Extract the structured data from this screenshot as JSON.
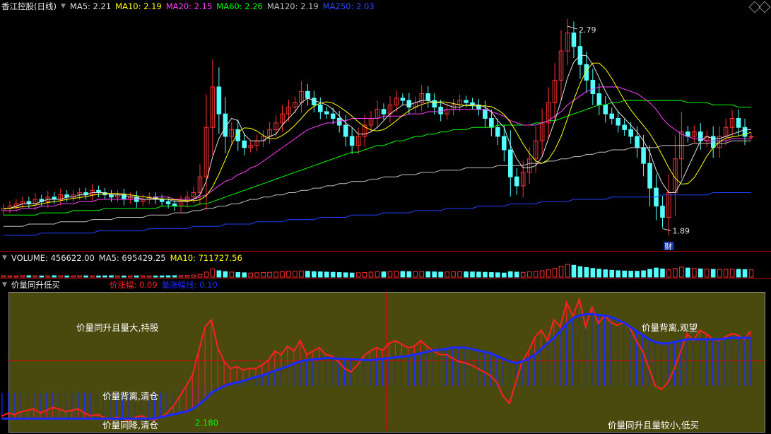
{
  "main_header": {
    "title": "香江控股(日线)",
    "ma5": "MA5: 2.21",
    "ma10": "MA10: 2.19",
    "ma20": "MA20: 2.15",
    "ma60": "MA60: 2.26",
    "ma120": "MA120: 2.19",
    "ma250": "MA250: 2.03"
  },
  "price_high_label": "2.79",
  "price_low_label": "1.89",
  "fin_badge": "财",
  "volume_header": {
    "volume": "VOLUME: 456622.00",
    "ma5": "MA5: 695429.25",
    "ma10": "MA10: 711727.56"
  },
  "indicator_header": {
    "name": "价量同升低买",
    "price_rise": "价涨幅: 0.09",
    "volume_line": "量涨幅线: 0.10"
  },
  "annotations": {
    "top_left": "价量同升且量大,持股",
    "top_right": "价量背离,观望",
    "mid_left": "价量背离,清仓",
    "bottom_left": "价量同降,清仓",
    "bottom_right": "价量同升且量较小,低买",
    "value_label": "2.180"
  },
  "colors": {
    "up": "#ff3232",
    "down": "#54ffff",
    "ma5": "#e0e0e0",
    "ma10": "#ffff00",
    "ma20": "#ff40ff",
    "ma60": "#00ff00",
    "ma120": "#c0c0c0",
    "ma250": "#2040ff",
    "price_rise": "#ff2020",
    "volume_line": "#1a2aff"
  },
  "chart_data": [
    {
      "type": "candlestick",
      "title": "香江控股(日线)",
      "ylim": [
        1.8,
        2.85
      ],
      "high_marker": 2.79,
      "low_marker": 1.89,
      "close": [
        1.98,
        1.99,
        2.0,
        2.01,
        2.0,
        2.02,
        2.01,
        2.03,
        2.02,
        2.04,
        2.03,
        2.04,
        2.05,
        2.04,
        2.06,
        2.05,
        2.04,
        2.03,
        2.04,
        2.02,
        2.03,
        2.01,
        2.02,
        2.03,
        2.02,
        2.01,
        2.0,
        1.99,
        2.01,
        2.03,
        2.05,
        2.12,
        2.34,
        2.52,
        2.4,
        2.3,
        2.33,
        2.28,
        2.25,
        2.26,
        2.28,
        2.3,
        2.33,
        2.36,
        2.4,
        2.43,
        2.45,
        2.5,
        2.47,
        2.44,
        2.41,
        2.4,
        2.38,
        2.35,
        2.3,
        2.26,
        2.3,
        2.35,
        2.38,
        2.42,
        2.4,
        2.44,
        2.47,
        2.46,
        2.43,
        2.45,
        2.49,
        2.46,
        2.43,
        2.4,
        2.42,
        2.44,
        2.46,
        2.45,
        2.44,
        2.42,
        2.38,
        2.34,
        2.3,
        2.24,
        2.12,
        2.08,
        2.14,
        2.2,
        2.28,
        2.36,
        2.45,
        2.55,
        2.68,
        2.76,
        2.7,
        2.62,
        2.55,
        2.49,
        2.44,
        2.4,
        2.38,
        2.35,
        2.33,
        2.3,
        2.25,
        2.18,
        2.07,
        1.99,
        1.94,
        2.05,
        2.2,
        2.32,
        2.3,
        2.32,
        2.28,
        2.3,
        2.25,
        2.3,
        2.34,
        2.38,
        2.34,
        2.3,
        2.3
      ],
      "ma5": [
        1.98,
        1.98,
        1.99,
        2.0,
        2.0,
        2.0,
        2.01,
        2.02,
        2.02,
        2.02,
        2.03,
        2.03,
        2.04,
        2.04,
        2.05,
        2.05,
        2.05,
        2.04,
        2.04,
        2.04,
        2.03,
        2.03,
        2.02,
        2.02,
        2.02,
        2.02,
        2.02,
        2.01,
        2.01,
        2.01,
        2.02,
        2.04,
        2.1,
        2.21,
        2.29,
        2.34,
        2.38,
        2.37,
        2.31,
        2.28,
        2.28,
        2.28,
        2.3,
        2.31,
        2.35,
        2.38,
        2.41,
        2.45,
        2.47,
        2.46,
        2.45,
        2.44,
        2.42,
        2.39,
        2.36,
        2.34,
        2.31,
        2.31,
        2.32,
        2.34,
        2.37,
        2.4,
        2.42,
        2.44,
        2.44,
        2.45,
        2.46,
        2.46,
        2.45,
        2.45,
        2.44,
        2.43,
        2.43,
        2.44,
        2.44,
        2.44,
        2.43,
        2.41,
        2.37,
        2.34,
        2.26,
        2.2,
        2.16,
        2.16,
        2.17,
        2.21,
        2.29,
        2.37,
        2.46,
        2.56,
        2.63,
        2.66,
        2.66,
        2.62,
        2.56,
        2.5,
        2.45,
        2.41,
        2.38,
        2.35,
        2.32,
        2.28,
        2.23,
        2.15,
        2.09,
        2.05,
        2.05,
        2.1,
        2.16,
        2.22,
        2.28,
        2.3,
        2.29,
        2.29,
        2.3,
        2.31,
        2.32,
        2.33,
        2.33
      ],
      "ma20": [
        1.97,
        1.97,
        1.97,
        1.98,
        1.98,
        1.98,
        1.99,
        1.99,
        1.99,
        2.0,
        2.0,
        2.0,
        2.01,
        2.01,
        2.01,
        2.02,
        2.02,
        2.02,
        2.02,
        2.02,
        2.02,
        2.02,
        2.02,
        2.02,
        2.03,
        2.03,
        2.03,
        2.02,
        2.02,
        2.02,
        2.02,
        2.03,
        2.04,
        2.06,
        2.08,
        2.1,
        2.11,
        2.13,
        2.14,
        2.16,
        2.17,
        2.19,
        2.21,
        2.23,
        2.25,
        2.27,
        2.29,
        2.31,
        2.33,
        2.34,
        2.35,
        2.36,
        2.36,
        2.37,
        2.37,
        2.38,
        2.38,
        2.38,
        2.38,
        2.38,
        2.39,
        2.39,
        2.39,
        2.39,
        2.4,
        2.4,
        2.4,
        2.41,
        2.41,
        2.41,
        2.42,
        2.42,
        2.42,
        2.42,
        2.42,
        2.42,
        2.42,
        2.41,
        2.4,
        2.39,
        2.37,
        2.36,
        2.35,
        2.35,
        2.35,
        2.36,
        2.37,
        2.39,
        2.41,
        2.44,
        2.46,
        2.48,
        2.5,
        2.51,
        2.52,
        2.52,
        2.52,
        2.52,
        2.51,
        2.5,
        2.49,
        2.47,
        2.45,
        2.42,
        2.38,
        2.35,
        2.33,
        2.31,
        2.3,
        2.29,
        2.29,
        2.28,
        2.28,
        2.28,
        2.28,
        2.29,
        2.29,
        2.29,
        2.29
      ],
      "ma60": [
        1.95,
        1.95,
        1.95,
        1.95,
        1.95,
        1.95,
        1.96,
        1.96,
        1.96,
        1.96,
        1.96,
        1.97,
        1.97,
        1.97,
        1.97,
        1.97,
        1.98,
        1.98,
        1.98,
        1.98,
        1.98,
        1.98,
        1.98,
        1.98,
        1.98,
        1.99,
        1.99,
        1.99,
        1.99,
        1.99,
        1.99,
        2.0,
        2.0,
        2.01,
        2.02,
        2.03,
        2.04,
        2.05,
        2.06,
        2.07,
        2.08,
        2.09,
        2.1,
        2.11,
        2.12,
        2.13,
        2.14,
        2.15,
        2.16,
        2.17,
        2.18,
        2.19,
        2.2,
        2.21,
        2.22,
        2.23,
        2.23,
        2.24,
        2.25,
        2.26,
        2.26,
        2.27,
        2.28,
        2.28,
        2.29,
        2.3,
        2.3,
        2.31,
        2.31,
        2.32,
        2.32,
        2.33,
        2.33,
        2.33,
        2.34,
        2.34,
        2.34,
        2.34,
        2.35,
        2.35,
        2.35,
        2.35,
        2.35,
        2.35,
        2.36,
        2.36,
        2.37,
        2.37,
        2.38,
        2.39,
        2.4,
        2.41,
        2.42,
        2.43,
        2.44,
        2.44,
        2.45,
        2.45,
        2.46,
        2.46,
        2.46,
        2.46,
        2.46,
        2.46,
        2.46,
        2.46,
        2.46,
        2.46,
        2.45,
        2.45,
        2.45,
        2.45,
        2.44,
        2.44,
        2.44,
        2.44,
        2.43,
        2.43,
        2.43
      ],
      "ma120": [
        1.9,
        1.9,
        1.9,
        1.9,
        1.91,
        1.91,
        1.91,
        1.91,
        1.91,
        1.92,
        1.92,
        1.92,
        1.92,
        1.92,
        1.93,
        1.93,
        1.93,
        1.93,
        1.94,
        1.94,
        1.94,
        1.94,
        1.94,
        1.95,
        1.95,
        1.95,
        1.95,
        1.96,
        1.96,
        1.96,
        1.97,
        1.97,
        1.98,
        1.98,
        1.99,
        1.99,
        2.0,
        2.0,
        2.01,
        2.02,
        2.02,
        2.03,
        2.03,
        2.04,
        2.04,
        2.05,
        2.05,
        2.06,
        2.06,
        2.07,
        2.07,
        2.08,
        2.08,
        2.09,
        2.09,
        2.1,
        2.1,
        2.1,
        2.11,
        2.11,
        2.12,
        2.12,
        2.12,
        2.13,
        2.13,
        2.13,
        2.14,
        2.14,
        2.14,
        2.15,
        2.15,
        2.15,
        2.15,
        2.16,
        2.16,
        2.16,
        2.16,
        2.16,
        2.17,
        2.17,
        2.17,
        2.17,
        2.17,
        2.18,
        2.18,
        2.18,
        2.19,
        2.19,
        2.2,
        2.2,
        2.21,
        2.21,
        2.22,
        2.22,
        2.23,
        2.23,
        2.24,
        2.24,
        2.24,
        2.25,
        2.25,
        2.25,
        2.25,
        2.25,
        2.26,
        2.26,
        2.26,
        2.26,
        2.26,
        2.27,
        2.27,
        2.27,
        2.27,
        2.27,
        2.27,
        2.28,
        2.28,
        2.28,
        2.28
      ],
      "ma250": [
        1.86,
        1.86,
        1.86,
        1.86,
        1.86,
        1.86,
        1.87,
        1.87,
        1.87,
        1.87,
        1.87,
        1.87,
        1.87,
        1.87,
        1.87,
        1.88,
        1.88,
        1.88,
        1.88,
        1.88,
        1.88,
        1.88,
        1.88,
        1.89,
        1.89,
        1.89,
        1.89,
        1.89,
        1.89,
        1.89,
        1.9,
        1.9,
        1.9,
        1.9,
        1.9,
        1.91,
        1.91,
        1.91,
        1.91,
        1.91,
        1.92,
        1.92,
        1.92,
        1.92,
        1.92,
        1.93,
        1.93,
        1.93,
        1.93,
        1.93,
        1.94,
        1.94,
        1.94,
        1.94,
        1.94,
        1.95,
        1.95,
        1.95,
        1.95,
        1.95,
        1.96,
        1.96,
        1.96,
        1.96,
        1.96,
        1.97,
        1.97,
        1.97,
        1.97,
        1.97,
        1.98,
        1.98,
        1.98,
        1.98,
        1.98,
        1.99,
        1.99,
        1.99,
        1.99,
        1.99,
        2.0,
        2.0,
        2.0,
        2.0,
        2.0,
        2.01,
        2.01,
        2.01,
        2.01,
        2.01,
        2.02,
        2.02,
        2.02,
        2.02,
        2.02,
        2.02,
        2.03,
        2.03,
        2.03,
        2.03,
        2.03,
        2.03,
        2.03,
        2.03,
        2.04,
        2.04,
        2.04,
        2.04,
        2.04,
        2.04,
        2.04,
        2.04,
        2.05,
        2.05,
        2.05,
        2.05,
        2.05,
        2.05,
        2.05
      ]
    },
    {
      "type": "bar",
      "title": "VOLUME",
      "values": [
        30,
        28,
        26,
        32,
        30,
        28,
        25,
        27,
        30,
        29,
        26,
        28,
        30,
        27,
        26,
        25,
        28,
        30,
        27,
        26,
        25,
        27,
        28,
        26,
        25,
        27,
        29,
        31,
        34,
        38,
        45,
        60,
        110,
        180,
        140,
        120,
        110,
        100,
        95,
        90,
        95,
        100,
        105,
        110,
        120,
        130,
        125,
        135,
        130,
        120,
        115,
        110,
        105,
        100,
        95,
        90,
        95,
        100,
        110,
        120,
        115,
        125,
        130,
        125,
        120,
        118,
        122,
        118,
        115,
        110,
        112,
        115,
        118,
        116,
        114,
        110,
        105,
        100,
        95,
        90,
        120,
        110,
        105,
        115,
        125,
        140,
        160,
        190,
        240,
        280,
        260,
        230,
        210,
        190,
        175,
        160,
        150,
        140,
        135,
        130,
        128,
        140,
        170,
        200,
        180,
        160,
        190,
        220,
        200,
        190,
        180,
        175,
        170,
        168,
        172,
        176,
        170,
        165,
        160
      ]
    },
    {
      "type": "line",
      "title": "价量同升低买",
      "ylim": [
        1.4,
        3.4
      ],
      "series": [
        {
          "name": "价涨幅",
          "values": [
            1.62,
            1.66,
            1.64,
            1.68,
            1.7,
            1.72,
            1.66,
            1.7,
            1.74,
            1.72,
            1.68,
            1.7,
            1.72,
            1.66,
            1.62,
            1.64,
            1.6,
            1.56,
            1.6,
            1.58,
            1.55,
            1.6,
            1.62,
            1.58,
            1.56,
            1.6,
            1.66,
            1.76,
            1.9,
            2.05,
            2.2,
            2.55,
            2.9,
            3.0,
            2.6,
            2.4,
            2.3,
            2.33,
            2.28,
            2.3,
            2.3,
            2.35,
            2.42,
            2.55,
            2.5,
            2.62,
            2.55,
            2.7,
            2.5,
            2.55,
            2.6,
            2.5,
            2.48,
            2.4,
            2.3,
            2.25,
            2.35,
            2.48,
            2.55,
            2.6,
            2.56,
            2.66,
            2.7,
            2.65,
            2.6,
            2.62,
            2.7,
            2.62,
            2.55,
            2.5,
            2.5,
            2.45,
            2.4,
            2.38,
            2.35,
            2.3,
            2.25,
            2.2,
            2.1,
            1.9,
            1.8,
            2.1,
            2.4,
            2.55,
            2.75,
            2.85,
            2.7,
            3.0,
            2.9,
            3.25,
            3.05,
            3.3,
            2.9,
            3.18,
            2.95,
            3.06,
            2.96,
            2.92,
            2.96,
            2.88,
            2.7,
            2.55,
            2.3,
            2.05,
            2.0,
            2.1,
            2.3,
            2.55,
            2.8,
            2.7,
            2.85,
            2.8,
            2.72,
            2.7,
            2.75,
            2.8,
            2.78,
            2.72,
            2.84
          ]
        },
        {
          "name": "量涨幅线",
          "values": [
            1.58,
            1.58,
            1.58,
            1.58,
            1.58,
            1.58,
            1.58,
            1.58,
            1.58,
            1.58,
            1.58,
            1.58,
            1.58,
            1.58,
            1.58,
            1.58,
            1.58,
            1.58,
            1.58,
            1.58,
            1.58,
            1.58,
            1.58,
            1.58,
            1.58,
            1.6,
            1.62,
            1.64,
            1.66,
            1.68,
            1.72,
            1.78,
            1.86,
            1.95,
            2.0,
            2.05,
            2.08,
            2.1,
            2.12,
            2.15,
            2.18,
            2.2,
            2.23,
            2.27,
            2.3,
            2.33,
            2.37,
            2.4,
            2.42,
            2.43,
            2.44,
            2.45,
            2.45,
            2.44,
            2.44,
            2.43,
            2.43,
            2.42,
            2.42,
            2.43,
            2.44,
            2.45,
            2.46,
            2.47,
            2.48,
            2.5,
            2.52,
            2.54,
            2.56,
            2.57,
            2.58,
            2.6,
            2.6,
            2.6,
            2.58,
            2.56,
            2.54,
            2.52,
            2.48,
            2.44,
            2.4,
            2.38,
            2.4,
            2.44,
            2.5,
            2.58,
            2.66,
            2.74,
            2.84,
            2.94,
            3.02,
            3.06,
            3.08,
            3.08,
            3.07,
            3.06,
            3.04,
            3.0,
            2.96,
            2.9,
            2.84,
            2.78,
            2.72,
            2.68,
            2.66,
            2.66,
            2.68,
            2.7,
            2.72,
            2.72,
            2.72,
            2.72,
            2.72,
            2.72,
            2.73,
            2.74,
            2.74,
            2.74,
            2.74
          ]
        }
      ]
    }
  ]
}
